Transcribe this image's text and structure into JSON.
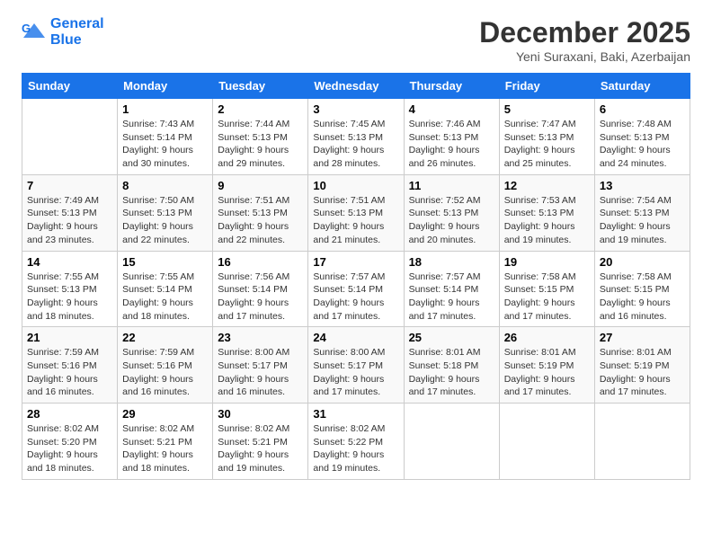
{
  "logo": {
    "line1": "General",
    "line2": "Blue"
  },
  "title": "December 2025",
  "location": "Yeni Suraxani, Baki, Azerbaijan",
  "days_header": [
    "Sunday",
    "Monday",
    "Tuesday",
    "Wednesday",
    "Thursday",
    "Friday",
    "Saturday"
  ],
  "weeks": [
    [
      {
        "day": "",
        "detail": ""
      },
      {
        "day": "1",
        "detail": "Sunrise: 7:43 AM\nSunset: 5:14 PM\nDaylight: 9 hours\nand 30 minutes."
      },
      {
        "day": "2",
        "detail": "Sunrise: 7:44 AM\nSunset: 5:13 PM\nDaylight: 9 hours\nand 29 minutes."
      },
      {
        "day": "3",
        "detail": "Sunrise: 7:45 AM\nSunset: 5:13 PM\nDaylight: 9 hours\nand 28 minutes."
      },
      {
        "day": "4",
        "detail": "Sunrise: 7:46 AM\nSunset: 5:13 PM\nDaylight: 9 hours\nand 26 minutes."
      },
      {
        "day": "5",
        "detail": "Sunrise: 7:47 AM\nSunset: 5:13 PM\nDaylight: 9 hours\nand 25 minutes."
      },
      {
        "day": "6",
        "detail": "Sunrise: 7:48 AM\nSunset: 5:13 PM\nDaylight: 9 hours\nand 24 minutes."
      }
    ],
    [
      {
        "day": "7",
        "detail": "Sunrise: 7:49 AM\nSunset: 5:13 PM\nDaylight: 9 hours\nand 23 minutes."
      },
      {
        "day": "8",
        "detail": "Sunrise: 7:50 AM\nSunset: 5:13 PM\nDaylight: 9 hours\nand 22 minutes."
      },
      {
        "day": "9",
        "detail": "Sunrise: 7:51 AM\nSunset: 5:13 PM\nDaylight: 9 hours\nand 22 minutes."
      },
      {
        "day": "10",
        "detail": "Sunrise: 7:51 AM\nSunset: 5:13 PM\nDaylight: 9 hours\nand 21 minutes."
      },
      {
        "day": "11",
        "detail": "Sunrise: 7:52 AM\nSunset: 5:13 PM\nDaylight: 9 hours\nand 20 minutes."
      },
      {
        "day": "12",
        "detail": "Sunrise: 7:53 AM\nSunset: 5:13 PM\nDaylight: 9 hours\nand 19 minutes."
      },
      {
        "day": "13",
        "detail": "Sunrise: 7:54 AM\nSunset: 5:13 PM\nDaylight: 9 hours\nand 19 minutes."
      }
    ],
    [
      {
        "day": "14",
        "detail": "Sunrise: 7:55 AM\nSunset: 5:13 PM\nDaylight: 9 hours\nand 18 minutes."
      },
      {
        "day": "15",
        "detail": "Sunrise: 7:55 AM\nSunset: 5:14 PM\nDaylight: 9 hours\nand 18 minutes."
      },
      {
        "day": "16",
        "detail": "Sunrise: 7:56 AM\nSunset: 5:14 PM\nDaylight: 9 hours\nand 17 minutes."
      },
      {
        "day": "17",
        "detail": "Sunrise: 7:57 AM\nSunset: 5:14 PM\nDaylight: 9 hours\nand 17 minutes."
      },
      {
        "day": "18",
        "detail": "Sunrise: 7:57 AM\nSunset: 5:14 PM\nDaylight: 9 hours\nand 17 minutes."
      },
      {
        "day": "19",
        "detail": "Sunrise: 7:58 AM\nSunset: 5:15 PM\nDaylight: 9 hours\nand 17 minutes."
      },
      {
        "day": "20",
        "detail": "Sunrise: 7:58 AM\nSunset: 5:15 PM\nDaylight: 9 hours\nand 16 minutes."
      }
    ],
    [
      {
        "day": "21",
        "detail": "Sunrise: 7:59 AM\nSunset: 5:16 PM\nDaylight: 9 hours\nand 16 minutes."
      },
      {
        "day": "22",
        "detail": "Sunrise: 7:59 AM\nSunset: 5:16 PM\nDaylight: 9 hours\nand 16 minutes."
      },
      {
        "day": "23",
        "detail": "Sunrise: 8:00 AM\nSunset: 5:17 PM\nDaylight: 9 hours\nand 16 minutes."
      },
      {
        "day": "24",
        "detail": "Sunrise: 8:00 AM\nSunset: 5:17 PM\nDaylight: 9 hours\nand 17 minutes."
      },
      {
        "day": "25",
        "detail": "Sunrise: 8:01 AM\nSunset: 5:18 PM\nDaylight: 9 hours\nand 17 minutes."
      },
      {
        "day": "26",
        "detail": "Sunrise: 8:01 AM\nSunset: 5:19 PM\nDaylight: 9 hours\nand 17 minutes."
      },
      {
        "day": "27",
        "detail": "Sunrise: 8:01 AM\nSunset: 5:19 PM\nDaylight: 9 hours\nand 17 minutes."
      }
    ],
    [
      {
        "day": "28",
        "detail": "Sunrise: 8:02 AM\nSunset: 5:20 PM\nDaylight: 9 hours\nand 18 minutes."
      },
      {
        "day": "29",
        "detail": "Sunrise: 8:02 AM\nSunset: 5:21 PM\nDaylight: 9 hours\nand 18 minutes."
      },
      {
        "day": "30",
        "detail": "Sunrise: 8:02 AM\nSunset: 5:21 PM\nDaylight: 9 hours\nand 19 minutes."
      },
      {
        "day": "31",
        "detail": "Sunrise: 8:02 AM\nSunset: 5:22 PM\nDaylight: 9 hours\nand 19 minutes."
      },
      {
        "day": "",
        "detail": ""
      },
      {
        "day": "",
        "detail": ""
      },
      {
        "day": "",
        "detail": ""
      }
    ]
  ]
}
